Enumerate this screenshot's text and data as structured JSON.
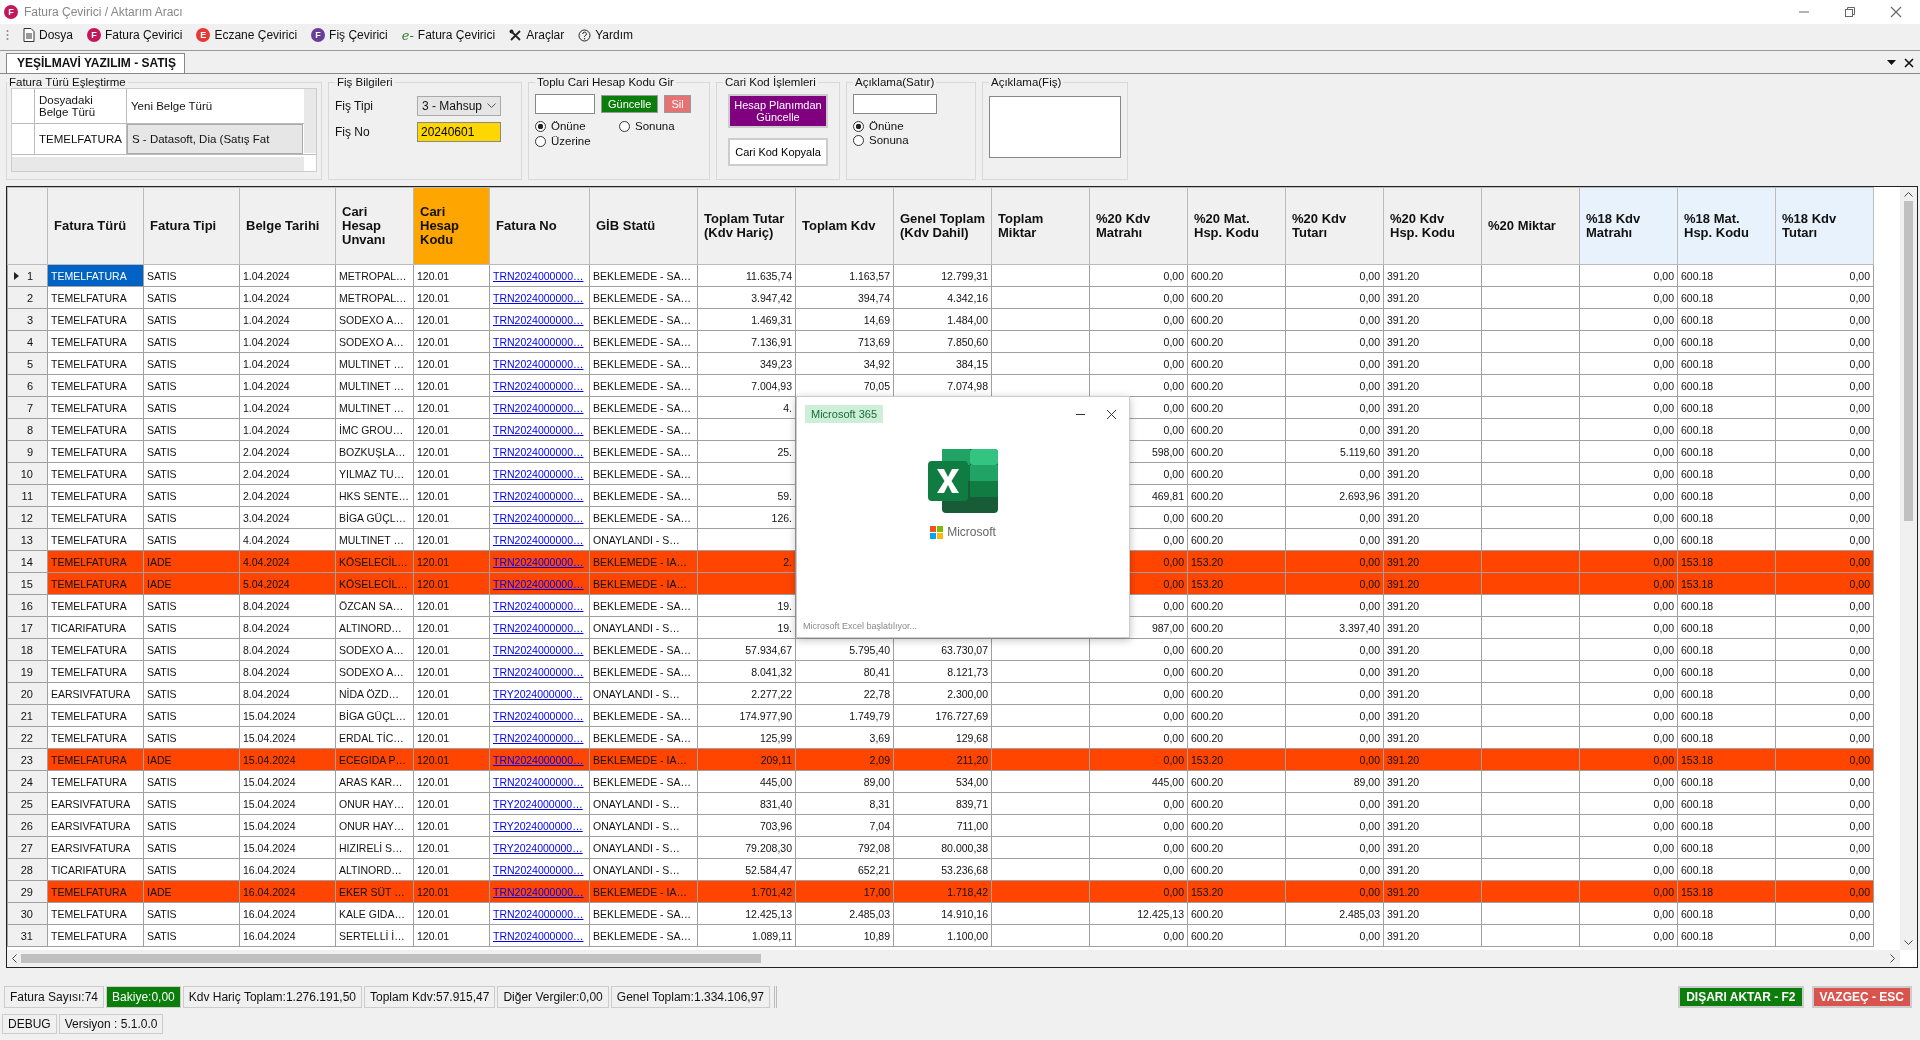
{
  "window": {
    "title": "Fatura Çevirici / Aktarım Aracı",
    "icon_letter": "F"
  },
  "menu": [
    {
      "label": "Dosya",
      "kind": "doc"
    },
    {
      "label": "Fatura Çevirici",
      "kind": "letter",
      "icon_letter": "F",
      "color": "#c2185b"
    },
    {
      "label": "Eczane Çevirici",
      "kind": "letter",
      "icon_letter": "E",
      "color": "#e53935"
    },
    {
      "label": "Fiş Çevirici",
      "kind": "letter",
      "icon_letter": "F",
      "color": "#6a3d9a"
    },
    {
      "label": "Fatura Çevirici",
      "kind": "script",
      "icon_letter": "e-",
      "color": "#2e7d32"
    },
    {
      "label": "Araçlar",
      "kind": "tools"
    },
    {
      "label": "Yardım",
      "kind": "help"
    }
  ],
  "tabs": [
    {
      "label": "YEŞİLMAVİ YAZILIM - SATIŞ",
      "selected": true
    }
  ],
  "type_mapping": {
    "title": "Fatura Türü Eşleştirme",
    "columns": [
      "Dosyadaki Belge Türü",
      "Yeni Belge Türü"
    ],
    "rows": [
      [
        "TEMELFATURA",
        "S - Datasoft, Dia (Satış Fat"
      ]
    ]
  },
  "fis": {
    "title": "Fiş Bilgileri",
    "type_label": "Fiş Tipi",
    "type_value": "3 - Mahsup",
    "no_label": "Fiş No",
    "no_value": "20240601"
  },
  "bulk": {
    "title": "Toplu Cari Hesap Kodu Gir",
    "update": "Güncelle",
    "delete": "Sil",
    "options": [
      {
        "label": "Önüne",
        "selected": true
      },
      {
        "label": "Sonuna",
        "selected": false
      },
      {
        "label": "Üzerine",
        "selected": false
      }
    ]
  },
  "cari": {
    "title": "Cari Kod İşlemleri",
    "buttons": [
      {
        "label": "Hesap Planımdan Güncelle",
        "kind": "primary"
      },
      {
        "label": "Cari Kod Kopyala",
        "kind": "plain"
      }
    ]
  },
  "line_note": {
    "title": "Açıklama(Satır)",
    "options": [
      {
        "label": "Önüne",
        "selected": true
      },
      {
        "label": "Sonuna",
        "selected": false
      }
    ]
  },
  "slip_note": {
    "title": "Açıklama(Fiş)"
  },
  "table": {
    "columns": [
      {
        "label": "Fatura Türü",
        "kind": "text",
        "color": "#f0f0f0"
      },
      {
        "label": "Fatura Tipi",
        "kind": "text",
        "color": "#f0f0f0"
      },
      {
        "label": "Belge Tarihi",
        "kind": "text",
        "color": "#f0f0f0"
      },
      {
        "label": "Cari Hesap Unvanı",
        "kind": "text",
        "color": "#f0f0f0"
      },
      {
        "label": "Cari Hesap Kodu",
        "kind": "text",
        "color": "#ffa500"
      },
      {
        "label": "Fatura No",
        "kind": "link",
        "color": "#f0f0f0"
      },
      {
        "label": "GİB Statü",
        "kind": "text",
        "color": "#f0f0f0"
      },
      {
        "label": "Toplam Tutar (Kdv Hariç)",
        "kind": "number",
        "color": "#f0f0f0"
      },
      {
        "label": "Toplam Kdv",
        "kind": "number",
        "color": "#f0f0f0"
      },
      {
        "label": "Genel Toplam (Kdv Dahil)",
        "kind": "number",
        "color": "#f0f0f0"
      },
      {
        "label": "Toplam Miktar",
        "kind": "number",
        "color": "#f0f0f0"
      },
      {
        "label": "%20 Kdv Matrahı",
        "kind": "number",
        "color": "#f0f0f0"
      },
      {
        "label": "%20 Mat. Hsp. Kodu",
        "kind": "text",
        "color": "#f0f0f0"
      },
      {
        "label": "%20 Kdv Tutarı",
        "kind": "number",
        "color": "#f0f0f0"
      },
      {
        "label": "%20 Kdv Hsp. Kodu",
        "kind": "text",
        "color": "#f0f0f0"
      },
      {
        "label": "%20 Miktar",
        "kind": "number",
        "color": "#f0f0f0"
      },
      {
        "label": "%18 Kdv Matrahı",
        "kind": "number",
        "color": "#e8f2fc"
      },
      {
        "label": "%18 Mat. Hsp. Kodu",
        "kind": "text",
        "color": "#e8f2fc"
      },
      {
        "label": "%18 Kdv Tutarı",
        "kind": "number",
        "color": "#e8f2fc"
      }
    ],
    "rows": [
      {
        "no": "1",
        "selected": true,
        "kind": "sale",
        "cells": [
          "TEMELFATURA",
          "SATIS",
          "1.04.2024",
          "METROPAL…",
          "120.01",
          "TRN2024000000…",
          "BEKLEMEDE - SA…",
          "11.635,74",
          "1.163,57",
          "12.799,31",
          null,
          "0,00",
          "600.20",
          "0,00",
          "391.20",
          null,
          "0,00",
          "600.18",
          "0,00"
        ]
      },
      {
        "no": "2",
        "selected": false,
        "kind": "sale",
        "cells": [
          "TEMELFATURA",
          "SATIS",
          "1.04.2024",
          "METROPAL…",
          "120.01",
          "TRN2024000000…",
          "BEKLEMEDE - SA…",
          "3.947,42",
          "394,74",
          "4.342,16",
          null,
          "0,00",
          "600.20",
          "0,00",
          "391.20",
          null,
          "0,00",
          "600.18",
          "0,00"
        ]
      },
      {
        "no": "3",
        "selected": false,
        "kind": "sale",
        "cells": [
          "TEMELFATURA",
          "SATIS",
          "1.04.2024",
          "SODEXO A…",
          "120.01",
          "TRN2024000000…",
          "BEKLEMEDE - SA…",
          "1.469,31",
          "14,69",
          "1.484,00",
          null,
          "0,00",
          "600.20",
          "0,00",
          "391.20",
          null,
          "0,00",
          "600.18",
          "0,00"
        ]
      },
      {
        "no": "4",
        "selected": false,
        "kind": "sale",
        "cells": [
          "TEMELFATURA",
          "SATIS",
          "1.04.2024",
          "SODEXO A…",
          "120.01",
          "TRN2024000000…",
          "BEKLEMEDE - SA…",
          "7.136,91",
          "713,69",
          "7.850,60",
          null,
          "0,00",
          "600.20",
          "0,00",
          "391.20",
          null,
          "0,00",
          "600.18",
          "0,00"
        ]
      },
      {
        "no": "5",
        "selected": false,
        "kind": "sale",
        "cells": [
          "TEMELFATURA",
          "SATIS",
          "1.04.2024",
          "MULTINET …",
          "120.01",
          "TRN2024000000…",
          "BEKLEMEDE - SA…",
          "349,23",
          "34,92",
          "384,15",
          null,
          "0,00",
          "600.20",
          "0,00",
          "391.20",
          null,
          "0,00",
          "600.18",
          "0,00"
        ]
      },
      {
        "no": "6",
        "selected": false,
        "kind": "sale",
        "cells": [
          "TEMELFATURA",
          "SATIS",
          "1.04.2024",
          "MULTINET …",
          "120.01",
          "TRN2024000000…",
          "BEKLEMEDE - SA…",
          "7.004,93",
          "70,05",
          "7.074,98",
          null,
          "0,00",
          "600.20",
          "0,00",
          "391.20",
          null,
          "0,00",
          "600.18",
          "0,00"
        ]
      },
      {
        "no": "7",
        "selected": false,
        "kind": "sale",
        "cells": [
          "TEMELFATURA",
          "SATIS",
          "1.04.2024",
          "MULTINET …",
          "120.01",
          "TRN2024000000…",
          "BEKLEMEDE - SA…",
          "4.",
          null,
          null,
          null,
          "0,00",
          "600.20",
          "0,00",
          "391.20",
          null,
          "0,00",
          "600.18",
          "0,00"
        ]
      },
      {
        "no": "8",
        "selected": false,
        "kind": "sale",
        "cells": [
          "TEMELFATURA",
          "SATIS",
          "1.04.2024",
          "İMC GROU…",
          "120.01",
          "TRN2024000000…",
          "BEKLEMEDE - SA…",
          null,
          null,
          null,
          null,
          "0,00",
          "600.20",
          "0,00",
          "391.20",
          null,
          "0,00",
          "600.18",
          "0,00"
        ]
      },
      {
        "no": "9",
        "selected": false,
        "kind": "sale",
        "cells": [
          "TEMELFATURA",
          "SATIS",
          "2.04.2024",
          "BOZKUŞLA…",
          "120.01",
          "TRN2024000000…",
          "BEKLEMEDE - SA…",
          "25.",
          null,
          null,
          null,
          "598,00",
          "600.20",
          "5.119,60",
          "391.20",
          null,
          "0,00",
          "600.18",
          "0,00"
        ]
      },
      {
        "no": "10",
        "selected": false,
        "kind": "sale",
        "cells": [
          "TEMELFATURA",
          "SATIS",
          "2.04.2024",
          "YILMAZ TU…",
          "120.01",
          "TRN2024000000…",
          "BEKLEMEDE - SA…",
          null,
          null,
          null,
          null,
          "0,00",
          "600.20",
          "0,00",
          "391.20",
          null,
          "0,00",
          "600.18",
          "0,00"
        ]
      },
      {
        "no": "11",
        "selected": false,
        "kind": "sale",
        "cells": [
          "TEMELFATURA",
          "SATIS",
          "2.04.2024",
          "HKS SENTE…",
          "120.01",
          "TRN2024000000…",
          "BEKLEMEDE - SA…",
          "59.",
          null,
          null,
          null,
          "469,81",
          "600.20",
          "2.693,96",
          "391.20",
          null,
          "0,00",
          "600.18",
          "0,00"
        ]
      },
      {
        "no": "12",
        "selected": false,
        "kind": "sale",
        "cells": [
          "TEMELFATURA",
          "SATIS",
          "3.04.2024",
          "BİGA GÜÇL…",
          "120.01",
          "TRN2024000000…",
          "BEKLEMEDE - SA…",
          "126.",
          null,
          null,
          null,
          "0,00",
          "600.20",
          "0,00",
          "391.20",
          null,
          "0,00",
          "600.18",
          "0,00"
        ]
      },
      {
        "no": "13",
        "selected": false,
        "kind": "sale",
        "cells": [
          "TEMELFATURA",
          "SATIS",
          "4.04.2024",
          "MULTINET …",
          "120.01",
          "TRN2024000000…",
          "ONAYLANDI - S…",
          null,
          null,
          null,
          null,
          "0,00",
          "600.20",
          "0,00",
          "391.20",
          null,
          "0,00",
          "600.18",
          "0,00"
        ]
      },
      {
        "no": "14",
        "selected": false,
        "kind": "return",
        "cells": [
          "TEMELFATURA",
          "IADE",
          "4.04.2024",
          "KÖSELECİL…",
          "120.01",
          "TRN2024000000…",
          "BEKLEMEDE - IA…",
          "2.",
          null,
          null,
          null,
          "0,00",
          "153.20",
          "0,00",
          "391.20",
          null,
          "0,00",
          "153.18",
          "0,00"
        ]
      },
      {
        "no": "15",
        "selected": false,
        "kind": "return",
        "cells": [
          "TEMELFATURA",
          "IADE",
          "5.04.2024",
          "KÖSELECİL…",
          "120.01",
          "TRN2024000000…",
          "BEKLEMEDE - IA…",
          null,
          null,
          null,
          null,
          "0,00",
          "153.20",
          "0,00",
          "391.20",
          null,
          "0,00",
          "153.18",
          "0,00"
        ]
      },
      {
        "no": "16",
        "selected": false,
        "kind": "sale",
        "cells": [
          "TEMELFATURA",
          "SATIS",
          "8.04.2024",
          "ÖZCAN SA…",
          "120.01",
          "TRN2024000000…",
          "BEKLEMEDE - SA…",
          "19.",
          null,
          null,
          null,
          "0,00",
          "600.20",
          "0,00",
          "391.20",
          null,
          "0,00",
          "600.18",
          "0,00"
        ]
      },
      {
        "no": "17",
        "selected": false,
        "kind": "sale",
        "cells": [
          "TICARIFATURA",
          "SATIS",
          "8.04.2024",
          "ALTINORD…",
          "120.01",
          "TRN2024000000…",
          "ONAYLANDI - S…",
          "19.",
          null,
          null,
          null,
          "987,00",
          "600.20",
          "3.397,40",
          "391.20",
          null,
          "0,00",
          "600.18",
          "0,00"
        ]
      },
      {
        "no": "18",
        "selected": false,
        "kind": "sale",
        "cells": [
          "TEMELFATURA",
          "SATIS",
          "8.04.2024",
          "SODEXO A…",
          "120.01",
          "TRN2024000000…",
          "BEKLEMEDE - SA…",
          "57.934,67",
          "5.795,40",
          "63.730,07",
          null,
          "0,00",
          "600.20",
          "0,00",
          "391.20",
          null,
          "0,00",
          "600.18",
          "0,00"
        ]
      },
      {
        "no": "19",
        "selected": false,
        "kind": "sale",
        "cells": [
          "TEMELFATURA",
          "SATIS",
          "8.04.2024",
          "SODEXO A…",
          "120.01",
          "TRN2024000000…",
          "BEKLEMEDE - SA…",
          "8.041,32",
          "80,41",
          "8.121,73",
          null,
          "0,00",
          "600.20",
          "0,00",
          "391.20",
          null,
          "0,00",
          "600.18",
          "0,00"
        ]
      },
      {
        "no": "20",
        "selected": false,
        "kind": "sale",
        "cells": [
          "EARSIVFATURA",
          "SATIS",
          "8.04.2024",
          "NİDA ÖZD…",
          "120.01",
          "TRY2024000000…",
          "ONAYLANDI - S…",
          "2.277,22",
          "22,78",
          "2.300,00",
          null,
          "0,00",
          "600.20",
          "0,00",
          "391.20",
          null,
          "0,00",
          "600.18",
          "0,00"
        ]
      },
      {
        "no": "21",
        "selected": false,
        "kind": "sale",
        "cells": [
          "TEMELFATURA",
          "SATIS",
          "15.04.2024",
          "BİGA GÜÇL…",
          "120.01",
          "TRN2024000000…",
          "BEKLEMEDE - SA…",
          "174.977,90",
          "1.749,79",
          "176.727,69",
          null,
          "0,00",
          "600.20",
          "0,00",
          "391.20",
          null,
          "0,00",
          "600.18",
          "0,00"
        ]
      },
      {
        "no": "22",
        "selected": false,
        "kind": "sale",
        "cells": [
          "TEMELFATURA",
          "SATIS",
          "15.04.2024",
          "ERDAL TİC…",
          "120.01",
          "TRN2024000000…",
          "BEKLEMEDE - SA…",
          "125,99",
          "3,69",
          "129,68",
          null,
          "0,00",
          "600.20",
          "0,00",
          "391.20",
          null,
          "0,00",
          "600.18",
          "0,00"
        ]
      },
      {
        "no": "23",
        "selected": false,
        "kind": "return",
        "cells": [
          "TEMELFATURA",
          "IADE",
          "15.04.2024",
          "ECEGIDA P…",
          "120.01",
          "TRN2024000000…",
          "BEKLEMEDE - IA…",
          "209,11",
          "2,09",
          "211,20",
          null,
          "0,00",
          "153.20",
          "0,00",
          "391.20",
          null,
          "0,00",
          "153.18",
          "0,00"
        ]
      },
      {
        "no": "24",
        "selected": false,
        "kind": "sale",
        "cells": [
          "TEMELFATURA",
          "SATIS",
          "15.04.2024",
          "ARAS KAR…",
          "120.01",
          "TRN2024000000…",
          "BEKLEMEDE - SA…",
          "445,00",
          "89,00",
          "534,00",
          null,
          "445,00",
          "600.20",
          "89,00",
          "391.20",
          null,
          "0,00",
          "600.18",
          "0,00"
        ]
      },
      {
        "no": "25",
        "selected": false,
        "kind": "sale",
        "cells": [
          "EARSIVFATURA",
          "SATIS",
          "15.04.2024",
          "ONUR HAY…",
          "120.01",
          "TRY2024000000…",
          "ONAYLANDI - S…",
          "831,40",
          "8,31",
          "839,71",
          null,
          "0,00",
          "600.20",
          "0,00",
          "391.20",
          null,
          "0,00",
          "600.18",
          "0,00"
        ]
      },
      {
        "no": "26",
        "selected": false,
        "kind": "sale",
        "cells": [
          "EARSIVFATURA",
          "SATIS",
          "15.04.2024",
          "ONUR HAY…",
          "120.01",
          "TRY2024000000…",
          "ONAYLANDI - S…",
          "703,96",
          "7,04",
          "711,00",
          null,
          "0,00",
          "600.20",
          "0,00",
          "391.20",
          null,
          "0,00",
          "600.18",
          "0,00"
        ]
      },
      {
        "no": "27",
        "selected": false,
        "kind": "sale",
        "cells": [
          "EARSIVFATURA",
          "SATIS",
          "15.04.2024",
          "HIZIRELİ S…",
          "120.01",
          "TRY2024000000…",
          "ONAYLANDI - S…",
          "79.208,30",
          "792,08",
          "80.000,38",
          null,
          "0,00",
          "600.20",
          "0,00",
          "391.20",
          null,
          "0,00",
          "600.18",
          "0,00"
        ]
      },
      {
        "no": "28",
        "selected": false,
        "kind": "sale",
        "cells": [
          "TICARIFATURA",
          "SATIS",
          "16.04.2024",
          "ALTINORD…",
          "120.01",
          "TRN2024000000…",
          "ONAYLANDI - S…",
          "52.584,47",
          "652,21",
          "53.236,68",
          null,
          "0,00",
          "600.20",
          "0,00",
          "391.20",
          null,
          "0,00",
          "600.18",
          "0,00"
        ]
      },
      {
        "no": "29",
        "selected": false,
        "kind": "return",
        "cells": [
          "TEMELFATURA",
          "IADE",
          "16.04.2024",
          "EKER SÜT …",
          "120.01",
          "TRN2024000000…",
          "BEKLEMEDE - IA…",
          "1.701,42",
          "17,00",
          "1.718,42",
          null,
          "0,00",
          "153.20",
          "0,00",
          "391.20",
          null,
          "0,00",
          "153.18",
          "0,00"
        ]
      },
      {
        "no": "30",
        "selected": false,
        "kind": "sale",
        "cells": [
          "TEMELFATURA",
          "SATIS",
          "16.04.2024",
          "KALE GIDA…",
          "120.01",
          "TRN2024000000…",
          "BEKLEMEDE - SA…",
          "12.425,13",
          "2.485,03",
          "14.910,16",
          null,
          "12.425,13",
          "600.20",
          "2.485,03",
          "391.20",
          null,
          "0,00",
          "600.18",
          "0,00"
        ]
      },
      {
        "no": "31",
        "selected": false,
        "kind": "sale",
        "cells": [
          "TEMELFATURA",
          "SATIS",
          "16.04.2024",
          "SERTELLİ İ…",
          "120.01",
          "TRN2024000000…",
          "BEKLEMEDE - SA…",
          "1.089,11",
          "10,89",
          "1.100,00",
          null,
          "0,00",
          "600.20",
          "0,00",
          "391.20",
          null,
          "0,00",
          "600.18",
          "0,00"
        ]
      }
    ]
  },
  "popup": {
    "badge": "Microsoft 365",
    "brand": "Microsoft",
    "message": "Microsoft Excel başlatılıyor..."
  },
  "status": [
    {
      "text": "Fatura Sayısı:74",
      "highlighted": false
    },
    {
      "text": "Bakiye:0,00",
      "highlighted": true
    },
    {
      "text": "Kdv Hariç Toplam:1.276.191,50",
      "highlighted": false
    },
    {
      "text": "Toplam Kdv:57.915,47",
      "highlighted": false
    },
    {
      "text": "Diğer Vergiler:0,00",
      "highlighted": false
    },
    {
      "text": "Genel Toplam:1.334.106,97",
      "highlighted": false
    }
  ],
  "actions": [
    {
      "label": "DIŞARI AKTAR - F2",
      "kind": "confirm"
    },
    {
      "label": "VAZGEÇ - ESC",
      "kind": "cancel"
    }
  ],
  "footer": [
    "DEBUG",
    "Versiyon : 5.1.0.0"
  ]
}
